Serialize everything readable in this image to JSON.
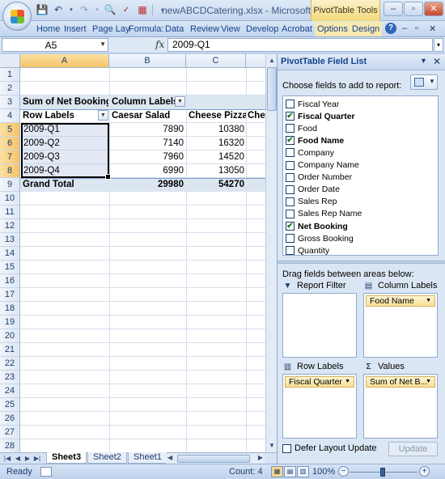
{
  "window": {
    "title": "newABCDCatering.xlsx - Microsoft...",
    "context_tab": "PivotTable Tools",
    "buttons": {
      "minimize": "–",
      "restore": "▫",
      "close": "✕"
    }
  },
  "ribbon": {
    "tabs": [
      "Home",
      "Insert",
      "Page Lay",
      "Formula:",
      "Data",
      "Review",
      "View",
      "Develop",
      "Acrobat",
      "Options",
      "Design"
    ],
    "help": "?"
  },
  "formula_bar": {
    "name_box": "A5",
    "fx": "fx",
    "value": "2009-Q1"
  },
  "sheet": {
    "columns": [
      "A",
      "B",
      "C"
    ],
    "row_numbers": [
      "1",
      "2",
      "3",
      "4",
      "5",
      "6",
      "7",
      "8",
      "9",
      "10",
      "11",
      "12",
      "13",
      "14",
      "15",
      "16",
      "17",
      "18",
      "19",
      "20",
      "21",
      "22",
      "23",
      "24",
      "25",
      "26",
      "27",
      "28"
    ],
    "pivot": {
      "data_header": "Sum of Net Booking",
      "column_labels": "Column Labels",
      "row_labels": "Row Labels",
      "col_items": [
        "Caesar Salad",
        "Cheese Pizza",
        "Chee"
      ],
      "rows": [
        {
          "label": "2009-Q1",
          "caesar": "7890",
          "cheese": "10380"
        },
        {
          "label": "2009-Q2",
          "caesar": "7140",
          "cheese": "16320"
        },
        {
          "label": "2009-Q3",
          "caesar": "7960",
          "cheese": "14520"
        },
        {
          "label": "2009-Q4",
          "caesar": "6990",
          "cheese": "13050"
        }
      ],
      "grand_total": {
        "label": "Grand Total",
        "caesar": "29980",
        "cheese": "54270"
      }
    },
    "tabs": [
      "Sheet3",
      "Sheet2",
      "Sheet1"
    ],
    "active_tab": "Sheet3"
  },
  "status_bar": {
    "ready": "Ready",
    "count": "Count: 4",
    "zoom": "100%"
  },
  "field_list": {
    "title": "PivotTable Field List",
    "choose_label": "Choose fields to add to report:",
    "fields": [
      {
        "name": "Fiscal Year",
        "checked": false
      },
      {
        "name": "Fiscal Quarter",
        "checked": true
      },
      {
        "name": "Food",
        "checked": false
      },
      {
        "name": "Food Name",
        "checked": true
      },
      {
        "name": "Company",
        "checked": false
      },
      {
        "name": "Company Name",
        "checked": false
      },
      {
        "name": "Order Number",
        "checked": false
      },
      {
        "name": "Order Date",
        "checked": false
      },
      {
        "name": "Sales Rep",
        "checked": false
      },
      {
        "name": "Sales Rep Name",
        "checked": false
      },
      {
        "name": "Net Booking",
        "checked": true
      },
      {
        "name": "Gross Booking",
        "checked": false
      },
      {
        "name": "Quantity",
        "checked": false
      }
    ],
    "drag_label": "Drag fields between areas below:",
    "areas": {
      "report_filter": {
        "label": "Report Filter"
      },
      "column_labels": {
        "label": "Column Labels",
        "chip": "Food Name"
      },
      "row_labels": {
        "label": "Row Labels",
        "chip": "Fiscal Quarter"
      },
      "values": {
        "label": "Values",
        "chip": "Sum of Net B..."
      }
    },
    "defer_label": "Defer Layout Update",
    "update_button": "Update"
  }
}
